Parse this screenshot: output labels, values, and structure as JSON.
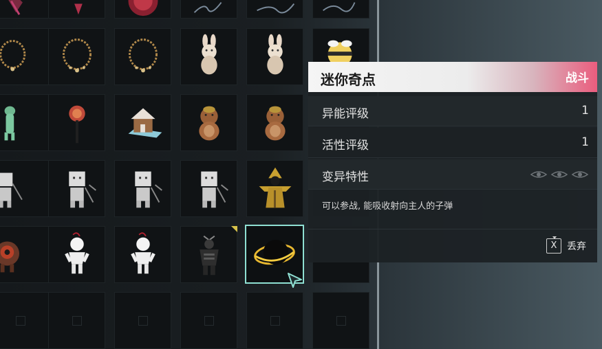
{
  "item_detail": {
    "name": "迷你奇点",
    "category": "战斗",
    "stats": [
      {
        "label": "异能评级",
        "value": "1"
      },
      {
        "label": "活性评级",
        "value": "1"
      }
    ],
    "mutation_label": "变异特性",
    "mutation_icons": [
      "eye-icon",
      "eye-icon",
      "eye-icon"
    ],
    "description": "可以参战, 能吸收射向主人的子弹",
    "drop_key": "X",
    "drop_label": "丢弃"
  },
  "inventory": {
    "rows": [
      [
        "red-cloth-item",
        "red-ornament-item",
        "lightning-item",
        "lightning-item",
        "lightning-item",
        "empty"
      ],
      [
        "bead-necklace-item",
        "bead-necklace-item",
        "bead-necklace-item",
        "bunny-plush-item",
        "bunny-plush-item",
        "bee-hat-item"
      ],
      [
        "dinosaur-figure-item",
        "lollipop-item",
        "gingerbread-house-item",
        "bear-plush-item",
        "bear-plush-item",
        "empty"
      ],
      [
        "robot-pickaxe-item",
        "robot-pickaxe-item",
        "robot-pickaxe-item",
        "robot-pickaxe-item",
        "scarecrow-item",
        "empty"
      ],
      [
        "red-creature-item",
        "paper-doll-item",
        "paper-doll-item",
        "samurai-armor-item",
        "mini-singularity-item",
        "empty"
      ],
      [
        "empty",
        "empty",
        "empty",
        "empty",
        "empty",
        "empty"
      ]
    ],
    "selected": "mini-singularity-item",
    "colors": {
      "selection": "#8fe0d3",
      "accent": "#ea5d7e",
      "new_flag": "#d6c24a"
    }
  }
}
